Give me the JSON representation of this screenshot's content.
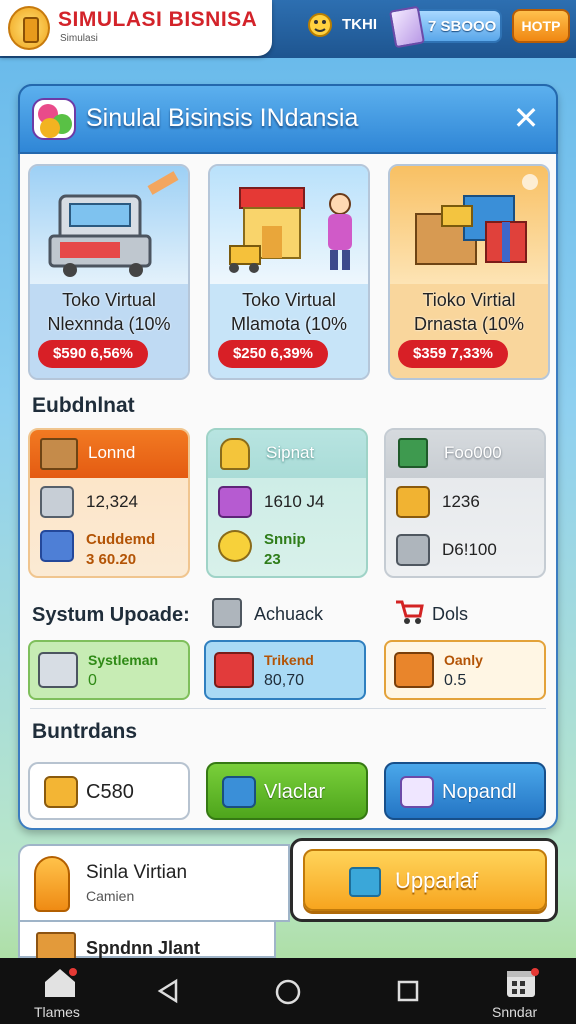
{
  "app": {
    "logo_title": "SIMULASI BISNISA",
    "logo_subtitle": "Simulasi"
  },
  "hud": {
    "coin_label": "TKHI",
    "cash_value": "7 SBOOO",
    "shop_label": "HOTP"
  },
  "panel": {
    "title": "Sinulal Bisinsis INdansia",
    "close_label": "✕",
    "stores": [
      {
        "name_line1": "Toko Virtual",
        "name_line2": "Nlexnnda (10%",
        "price": "$590 6,56%",
        "theme": "blue",
        "icon": "cash-register-icon"
      },
      {
        "name_line1": "Toko Virtual",
        "name_line2": "Mlamota (10%",
        "price": "$250 6,39%",
        "theme": "light-blue",
        "icon": "shop-front-icon"
      },
      {
        "name_line1": "Tioko Virtial",
        "name_line2": "Drnasta (10%",
        "price": "$359 7,33%",
        "theme": "orange",
        "icon": "gift-boxes-icon"
      }
    ],
    "stats_label": "Eubdnlnat",
    "stats": [
      {
        "header": "Lonnd",
        "header_icon": "crate-icon",
        "rows": [
          {
            "icon": "servers-icon",
            "value": "12,324"
          },
          {
            "icon": "gift-icon",
            "value": "Cuddemd\n3 60.20"
          }
        ]
      },
      {
        "header": "Sipnat",
        "header_icon": "bell-icon",
        "rows": [
          {
            "icon": "basket-icon",
            "value": "1610 J4"
          },
          {
            "icon": "tag-icon",
            "value": "Snnip\n23"
          }
        ]
      },
      {
        "header": "Foo000",
        "header_icon": "box-icon",
        "rows": [
          {
            "icon": "bag-icon",
            "value": "1236"
          },
          {
            "icon": "register-icon",
            "value": "D6!100"
          }
        ]
      }
    ],
    "system_label": "Systum Upoade:",
    "system_headers": [
      {
        "icon": "cabinet-icon",
        "label": "Achuack"
      },
      {
        "icon": "cart-icon",
        "label": "Dols"
      }
    ],
    "upgrades": [
      {
        "title": "Systleman",
        "value": "0",
        "icon": "shopping-cart-icon"
      },
      {
        "title": "Trikend",
        "value": "80,70",
        "icon": "red-box-icon"
      },
      {
        "title": "Oanly",
        "value": "0.5",
        "icon": "gift-box-icon"
      }
    ],
    "buttons_label": "Buntrdans",
    "buttons": [
      {
        "label": "C580",
        "icon": "package-icon"
      },
      {
        "label": "Vlaclar",
        "icon": "check-icon"
      },
      {
        "label": "Nopandl",
        "icon": "checklist-icon"
      }
    ]
  },
  "bottom": {
    "profile_name": "Sinla Virtian",
    "profile_sub": "Camien",
    "second_name": "Spndnn Jlant",
    "upgrade_label": "Upparlaf"
  },
  "navbar": {
    "left_label": "Tlames",
    "right_label": "Snndar"
  },
  "colors": {
    "brand_red": "#d3232a",
    "accent_blue": "#2f86d6",
    "accent_orange": "#f7a51f",
    "accent_green": "#5fba2a"
  }
}
